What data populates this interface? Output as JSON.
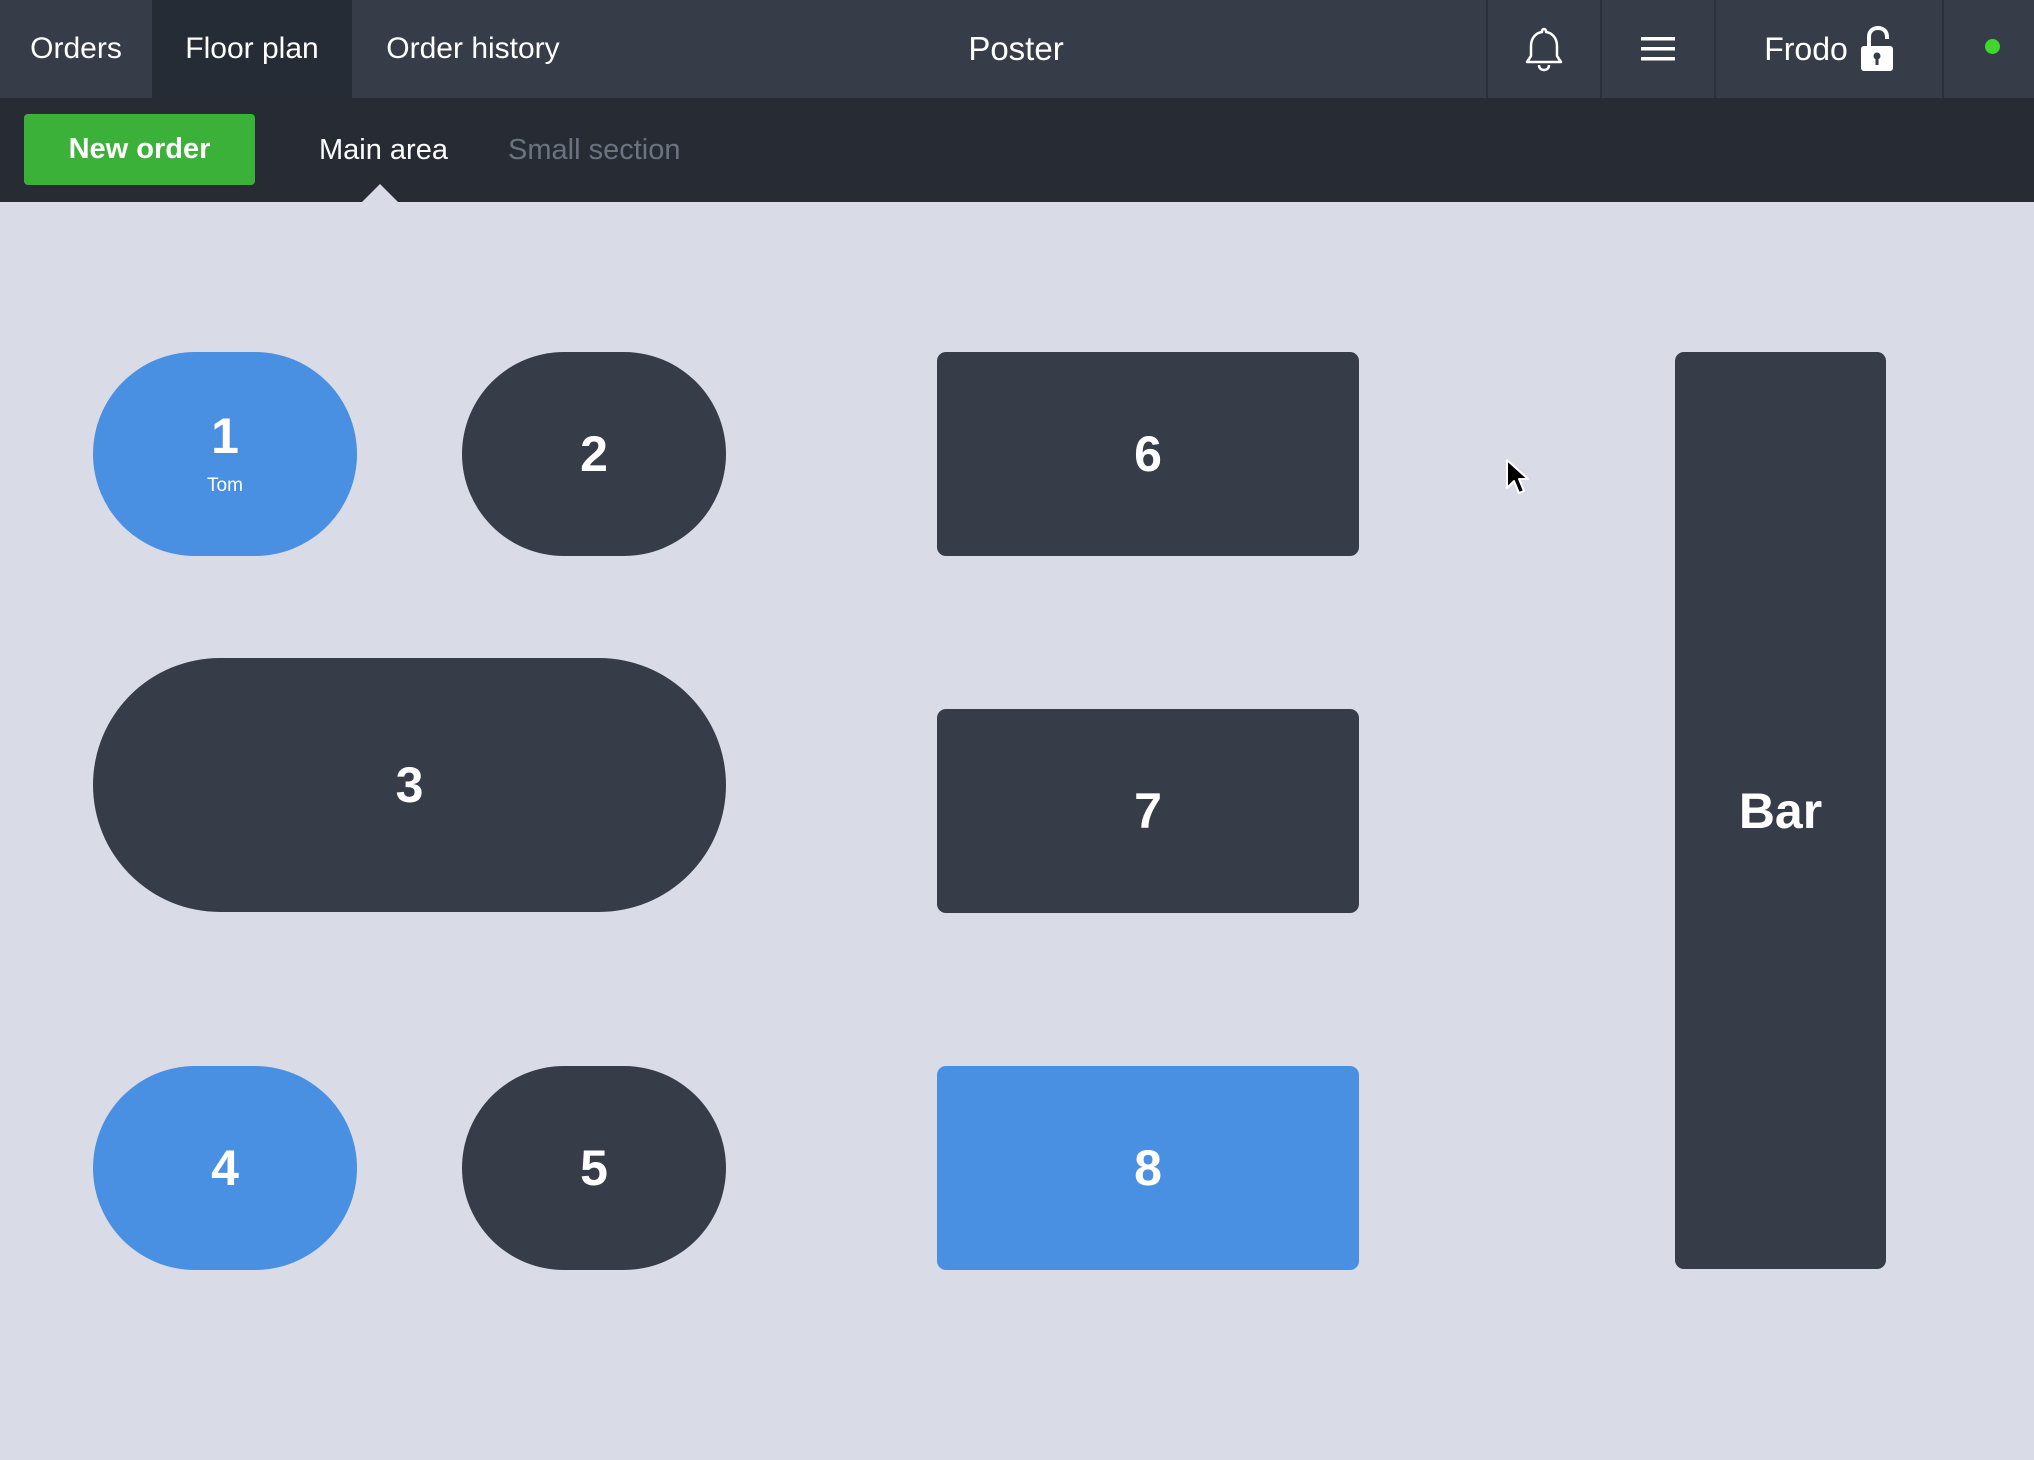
{
  "header": {
    "tabs": [
      {
        "label": "Orders",
        "active": false
      },
      {
        "label": "Floor plan",
        "active": true
      },
      {
        "label": "Order history",
        "active": false
      }
    ],
    "title": "Poster",
    "icons": [
      "bell-icon",
      "menu-icon"
    ],
    "user": {
      "name": "Frodo",
      "icon": "unlocked-padlock-icon"
    },
    "status": {
      "online": true,
      "color": "#3fd72e"
    }
  },
  "toolbar": {
    "new_order_label": "New order",
    "sections": [
      {
        "label": "Main area",
        "active": true
      },
      {
        "label": "Small section",
        "active": false
      }
    ]
  },
  "floor": {
    "tables": [
      {
        "id": "1",
        "shape": "round",
        "status": "occupied",
        "guest": "Tom"
      },
      {
        "id": "2",
        "shape": "round",
        "status": "free"
      },
      {
        "id": "3",
        "shape": "round",
        "status": "free"
      },
      {
        "id": "4",
        "shape": "round",
        "status": "occupied"
      },
      {
        "id": "5",
        "shape": "round",
        "status": "free"
      },
      {
        "id": "6",
        "shape": "rect",
        "status": "free"
      },
      {
        "id": "7",
        "shape": "rect",
        "status": "free"
      },
      {
        "id": "8",
        "shape": "rect",
        "status": "occupied"
      },
      {
        "id": "Bar",
        "shape": "rect",
        "status": "free"
      }
    ]
  },
  "colors": {
    "topbar": "#363c48",
    "subbar": "#262b34",
    "floor_bg": "#d9dbe7",
    "table_free": "#363c48",
    "table_occupied": "#4a90e2",
    "new_order": "#3cb13a"
  }
}
